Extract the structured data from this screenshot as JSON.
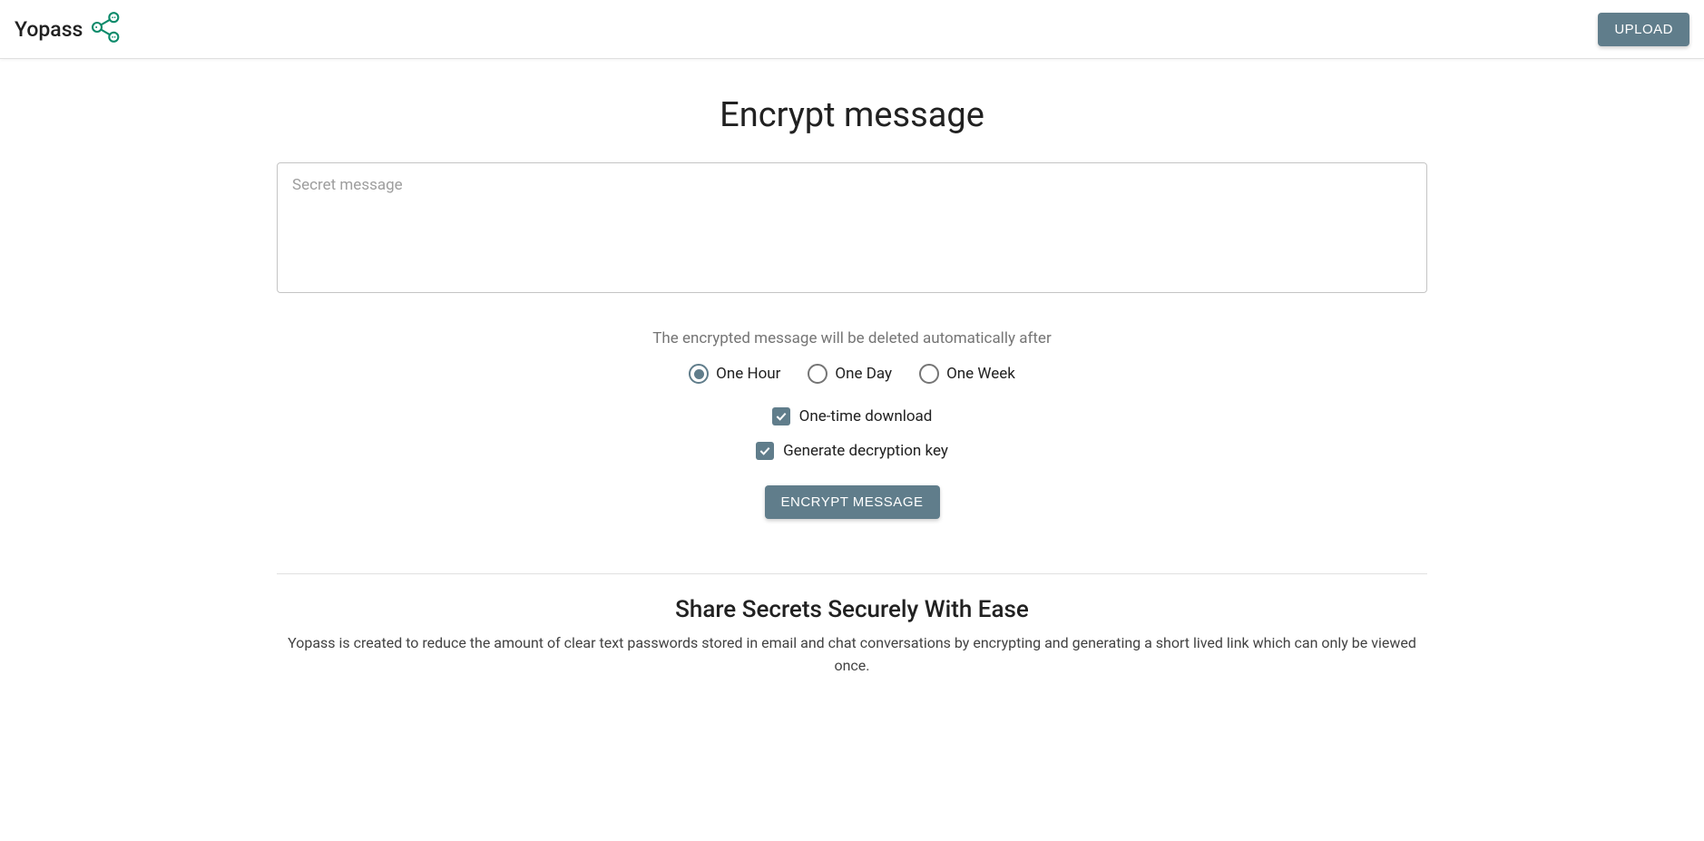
{
  "header": {
    "brand": "Yopass",
    "upload_label": "UPLOAD"
  },
  "main": {
    "title": "Encrypt message",
    "secret_placeholder": "Secret message",
    "expiry_helper": "The encrypted message will be deleted automatically after",
    "expiry_options": [
      {
        "label": "One Hour",
        "checked": true
      },
      {
        "label": "One Day",
        "checked": false
      },
      {
        "label": "One Week",
        "checked": false
      }
    ],
    "one_time_label": "One-time download",
    "one_time_checked": true,
    "generate_key_label": "Generate decryption key",
    "generate_key_checked": true,
    "submit_label": "ENCRYPT MESSAGE"
  },
  "footer": {
    "title": "Share Secrets Securely With Ease",
    "description": "Yopass is created to reduce the amount of clear text passwords stored in email and chat conversations by encrypting and generating a short lived link which can only be viewed once."
  }
}
